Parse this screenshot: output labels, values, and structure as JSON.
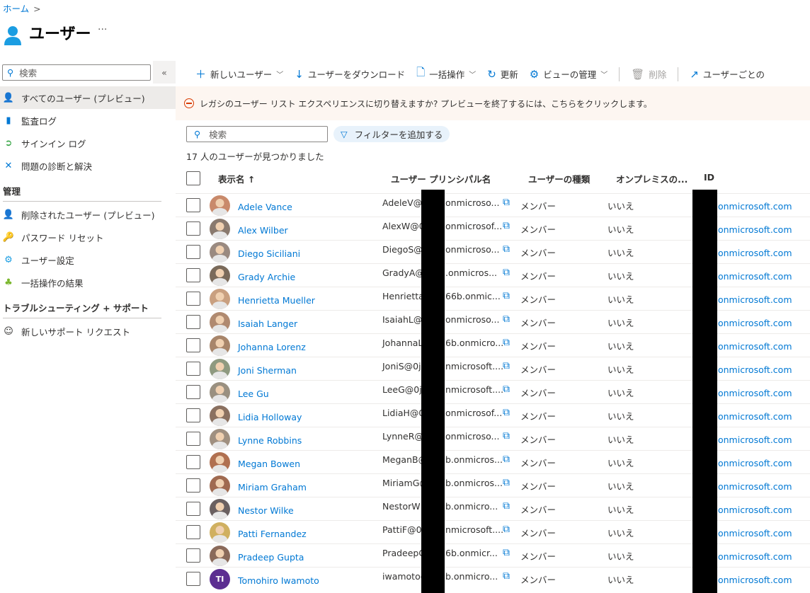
{
  "breadcrumb": {
    "home": "ホーム",
    "sep": ">"
  },
  "page": {
    "title": "ユーザー",
    "more": "···"
  },
  "sidebar": {
    "search_placeholder": "検索",
    "collapse": "«",
    "items": [
      {
        "label": "すべてのユーザー (プレビュー)",
        "icon": "user-icon",
        "color": "#0078d4"
      },
      {
        "label": "監査ログ",
        "icon": "log-book-icon",
        "color": "#0078d4"
      },
      {
        "label": "サインイン ログ",
        "icon": "sign-in-icon",
        "color": "#0078d4"
      },
      {
        "label": "問題の診断と解決",
        "icon": "wrench-icon",
        "color": "#0078d4"
      }
    ],
    "sections": [
      {
        "title": "管理",
        "items": [
          {
            "label": "削除されたユーザー (プレビュー)",
            "icon": "deleted-user-icon"
          },
          {
            "label": "パスワード リセット",
            "icon": "key-icon"
          },
          {
            "label": "ユーザー設定",
            "icon": "user-settings-icon"
          },
          {
            "label": "一括操作の結果",
            "icon": "bulk-results-icon"
          }
        ]
      },
      {
        "title": "トラブルシューティング + サポート",
        "items": [
          {
            "label": "新しいサポート リクエスト",
            "icon": "support-icon"
          }
        ]
      }
    ]
  },
  "toolbar": {
    "new_user": "新しいユーザー",
    "download": "ユーザーをダウンロード",
    "bulk": "一括操作",
    "refresh": "更新",
    "manage_view": "ビューの管理",
    "delete": "削除",
    "per_user": "ユーザーごとの"
  },
  "banner": {
    "text": "レガシのユーザー リスト エクスペリエンスに切り替えますか? プレビューを終了するには、こちらをクリックします。"
  },
  "list": {
    "search_placeholder": "検索",
    "add_filter": "フィルターを追加する",
    "count": "17 人のユーザーが見つかりました",
    "columns": {
      "name": "表示名 ↑",
      "upn": "ユーザー プリンシパル名",
      "type": "ユーザーの種類",
      "onprem": "オンプレミスの...",
      "id": "ID"
    },
    "rows": [
      {
        "name": "Adele Vance",
        "upn_a": "AdeleV@0",
        "upn_b": "onmicroso...",
        "type": "メンバー",
        "onprem": "いいえ",
        "id": ".onmicrosoft.com",
        "avatar": "#c98a6b"
      },
      {
        "name": "Alex Wilber",
        "upn_a": "AlexW@0j",
        "upn_b": "onmicrosof...",
        "type": "メンバー",
        "onprem": "いいえ",
        "id": ".onmicrosoft.com",
        "avatar": "#8a7a6e"
      },
      {
        "name": "Diego Siciliani",
        "upn_a": "DiegoS@0",
        "upn_b": "onmicroso...",
        "type": "メンバー",
        "onprem": "いいえ",
        "id": ".onmicrosoft.com",
        "avatar": "#9a8a80"
      },
      {
        "name": "Grady Archie",
        "upn_a": "GradyA@",
        "upn_b": ".onmicros...",
        "type": "メンバー",
        "onprem": "いいえ",
        "id": ".onmicrosoft.com",
        "avatar": "#7a6a5a"
      },
      {
        "name": "Henrietta Mueller",
        "upn_a": "Henrietta",
        "upn_b": "66b.onmic...",
        "type": "メンバー",
        "onprem": "いいえ",
        "id": ".onmicrosoft.com",
        "avatar": "#c9a080"
      },
      {
        "name": "Isaiah Langer",
        "upn_a": "IsaiahL@0",
        "upn_b": "onmicroso...",
        "type": "メンバー",
        "onprem": "いいえ",
        "id": ".onmicrosoft.com",
        "avatar": "#b08a70"
      },
      {
        "name": "Johanna Lorenz",
        "upn_a": "JohannaL",
        "upn_b": "6b.onmicro...",
        "type": "メンバー",
        "onprem": "いいえ",
        "id": ".onmicrosoft.com",
        "avatar": "#a8856a"
      },
      {
        "name": "Joni Sherman",
        "upn_a": "JoniS@0j6",
        "upn_b": "nmicrosoft....",
        "type": "メンバー",
        "onprem": "いいえ",
        "id": ".onmicrosoft.com",
        "avatar": "#8f9a80"
      },
      {
        "name": "Lee Gu",
        "upn_a": "LeeG@0j6",
        "upn_b": "nmicrosoft....",
        "type": "メンバー",
        "onprem": "いいえ",
        "id": ".onmicrosoft.com",
        "avatar": "#9a9080"
      },
      {
        "name": "Lidia Holloway",
        "upn_a": "LidiaH@0j",
        "upn_b": "onmicrosof...",
        "type": "メンバー",
        "onprem": "いいえ",
        "id": ".onmicrosoft.com",
        "avatar": "#8a7060"
      },
      {
        "name": "Lynne Robbins",
        "upn_a": "LynneR@",
        "upn_b": "onmicroso...",
        "type": "メンバー",
        "onprem": "いいえ",
        "id": ".onmicrosoft.com",
        "avatar": "#a09080"
      },
      {
        "name": "Megan Bowen",
        "upn_a": "MeganB@",
        "upn_b": "b.onmicros...",
        "type": "メンバー",
        "onprem": "いいえ",
        "id": ".onmicrosoft.com",
        "avatar": "#b07050"
      },
      {
        "name": "Miriam Graham",
        "upn_a": "MiriamG@",
        "upn_b": "b.onmicros...",
        "type": "メンバー",
        "onprem": "いいえ",
        "id": ".onmicrosoft.com",
        "avatar": "#a06a50"
      },
      {
        "name": "Nestor Wilke",
        "upn_a": "NestorW",
        "upn_b": "b.onmicro...",
        "type": "メンバー",
        "onprem": "いいえ",
        "id": ".onmicrosoft.com",
        "avatar": "#6a6060"
      },
      {
        "name": "Patti Fernandez",
        "upn_a": "PattiF@0j",
        "upn_b": "nmicrosoft....",
        "type": "メンバー",
        "onprem": "いいえ",
        "id": ".onmicrosoft.com",
        "avatar": "#d0b060"
      },
      {
        "name": "Pradeep Gupta",
        "upn_a": "PradeepG",
        "upn_b": "6b.onmicr...",
        "type": "メンバー",
        "onprem": "いいえ",
        "id": ".onmicrosoft.com",
        "avatar": "#8a6a5a"
      },
      {
        "name": "Tomohiro Iwamoto",
        "upn_a": "iwamoto@",
        "upn_b": "b.onmicro...",
        "type": "メンバー",
        "onprem": "いいえ",
        "id": ".onmicrosoft.com",
        "avatar": "#5c2e91",
        "initials": "TI"
      }
    ]
  }
}
